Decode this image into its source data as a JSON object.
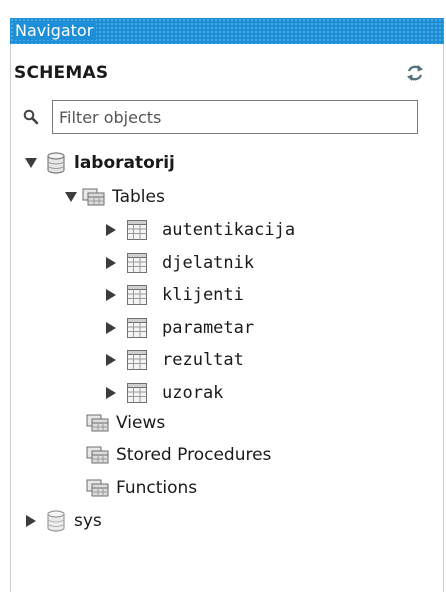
{
  "navigator": {
    "title": "Navigator"
  },
  "schemas": {
    "title": "SCHEMAS",
    "filter_placeholder": "Filter objects"
  },
  "tree": {
    "schema1": {
      "name": "laboratorij",
      "tables_label": "Tables",
      "tables": [
        "autentikacija",
        "djelatnik",
        "klijenti",
        "parametar",
        "rezultat",
        "uzorak"
      ],
      "views_label": "Views",
      "procedures_label": "Stored Procedures",
      "functions_label": "Functions"
    },
    "schema2": {
      "name": "sys"
    }
  },
  "icons": {
    "refresh": "refresh-icon",
    "search": "search-icon",
    "database": "database-icon",
    "folder": "folder-icon",
    "table": "table-icon",
    "expand": "triangle-right-icon",
    "collapse": "triangle-down-icon"
  },
  "colors": {
    "title_bar": "#1d8fd8",
    "title_text": "#ffffff"
  }
}
